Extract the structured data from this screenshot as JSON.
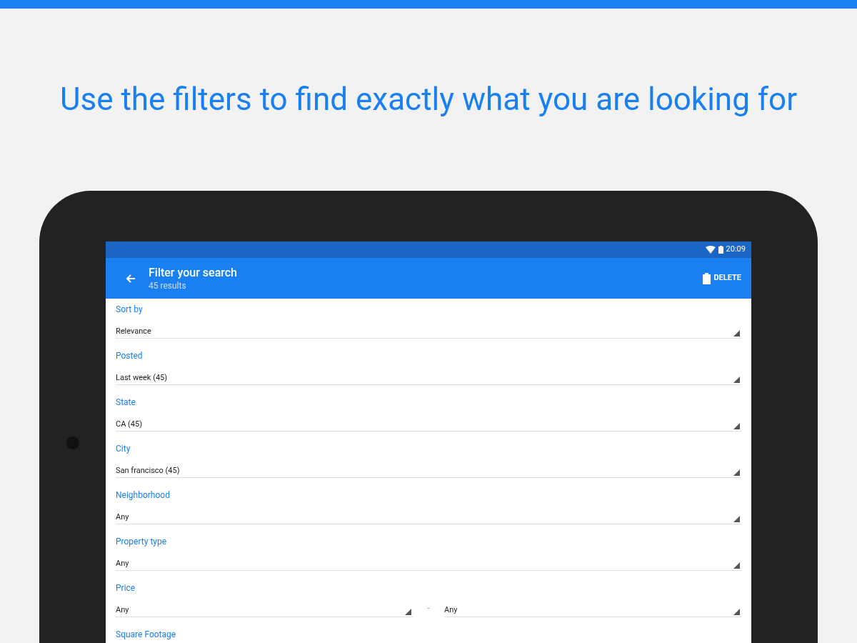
{
  "headline": "Use the filters to find exactly what you are looking for",
  "status_bar": {
    "time": "20:09"
  },
  "app_bar": {
    "title": "Filter your search",
    "subtitle": "45 results",
    "action": "DELETE"
  },
  "fields": [
    {
      "kind": "single",
      "label": "Sort by",
      "value": "Relevance"
    },
    {
      "kind": "single",
      "label": "Posted",
      "value": "Last week (45)"
    },
    {
      "kind": "single",
      "label": "State",
      "value": "CA (45)"
    },
    {
      "kind": "single",
      "label": "City",
      "value": "San francisco (45)"
    },
    {
      "kind": "single",
      "label": "Neighborhood",
      "value": "Any"
    },
    {
      "kind": "single",
      "label": "Property type",
      "value": "Any"
    },
    {
      "kind": "range",
      "label": "Price",
      "from": "Any",
      "separator": "-",
      "to": "Any"
    },
    {
      "kind": "label",
      "label": "Square Footage"
    }
  ]
}
